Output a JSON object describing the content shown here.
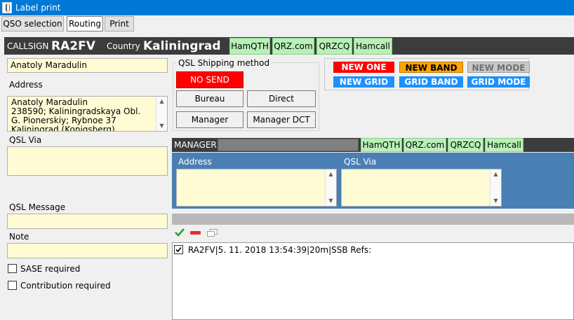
{
  "window": {
    "title": "Label print"
  },
  "tabs": [
    "QSO selection",
    "Routing",
    "Print"
  ],
  "callsign_bar": {
    "callsign_label": "CALLSIGN",
    "callsign": "RA2FV",
    "country_label": "Country",
    "country": "Kaliningrad",
    "links": [
      "HamQTH",
      "QRZ.com",
      "QRZCQ",
      "Hamcall"
    ]
  },
  "left": {
    "name": "Anatoly Maradulin",
    "address_label": "Address",
    "address_lines": [
      "Anatoly Maradulin",
      "238590; Kaliningradskaya Obl.",
      "G. Pionerskiy; Rybnoe 37",
      "Kaliningrad (Konigsberg)"
    ],
    "qsl_via_label": "QSL Via",
    "qsl_via": "",
    "qsl_message_label": "QSL Message",
    "qsl_message": "",
    "note_label": "Note",
    "note": "",
    "sase_label": "SASE required",
    "contribution_label": "Contribution required"
  },
  "shipping": {
    "title": "QSL Shipping method",
    "no_send": "NO SEND",
    "bureau": "Bureau",
    "direct": "Direct",
    "manager": "Manager",
    "manager_dct": "Manager DCT"
  },
  "flags": {
    "new_one": "NEW ONE",
    "new_band": "NEW BAND",
    "new_mode": "NEW MODE",
    "new_grid": "NEW GRID",
    "grid_band": "GRID BAND",
    "grid_mode": "GRID MODE",
    "colors": {
      "new_one": "#ff0000",
      "new_band": "#ffa500",
      "new_mode": "#c0c0c0",
      "grid": "#1e90ff"
    }
  },
  "manager": {
    "label": "MANAGER",
    "links": [
      "HamQTH",
      "QRZ.com",
      "QRZCQ",
      "Hamcall"
    ],
    "address_label": "Address",
    "qsl_via_label": "QSL Via"
  },
  "list": {
    "toolbar_icons": [
      "check-icon",
      "minus-icon",
      "window-icon"
    ],
    "items": [
      {
        "checked": true,
        "text": "RA2FV|5. 11. 2018 13:54:39|20m|SSB Refs:"
      }
    ]
  }
}
